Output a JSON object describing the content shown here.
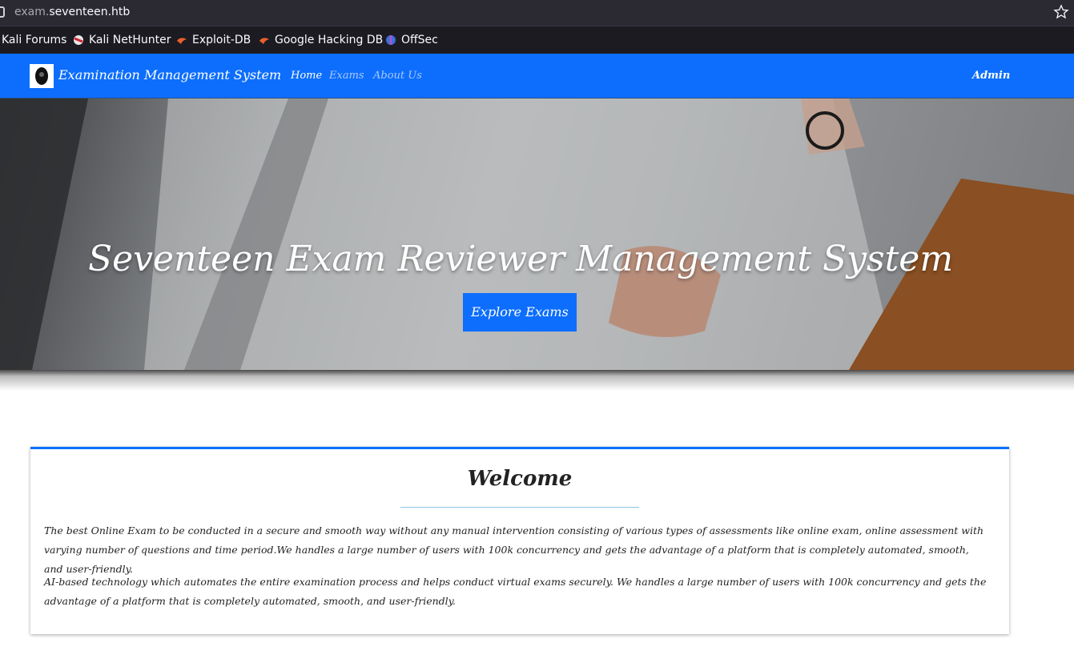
{
  "browser": {
    "url_subdomain": "exam.",
    "url_domain": "seventeen.htb"
  },
  "bookmarks": [
    {
      "label": "Kali Forums",
      "icon": "kali-icon"
    },
    {
      "label": "Kali NetHunter",
      "icon": "nethunter-icon"
    },
    {
      "label": "Exploit-DB",
      "icon": "exploitdb-icon"
    },
    {
      "label": "Google Hacking DB",
      "icon": "ghdb-icon"
    },
    {
      "label": "OffSec",
      "icon": "offsec-icon"
    }
  ],
  "navbar": {
    "brand": "Examination Management System",
    "links": [
      "Home",
      "Exams",
      "About Us"
    ],
    "admin": "Admin",
    "color": "#0d6efd"
  },
  "hero": {
    "title": "Seventeen Exam Reviewer Management System",
    "button": "Explore Exams"
  },
  "welcome": {
    "title": "Welcome",
    "paragraphs": [
      "The best Online Exam to be conducted in a secure and smooth way without any manual intervention consisting of various types of assessments like online exam, online assessment with varying number of questions and time period.We handles a large number of users with 100k concurrency and gets the advantage of a platform that is completely automated, smooth, and user-friendly.",
      "AI-based technology which automates the entire examination process and helps conduct virtual exams securely. We handles a large number of users with 100k concurrency and gets the advantage of a platform that is completely automated, smooth, and user-friendly."
    ]
  }
}
